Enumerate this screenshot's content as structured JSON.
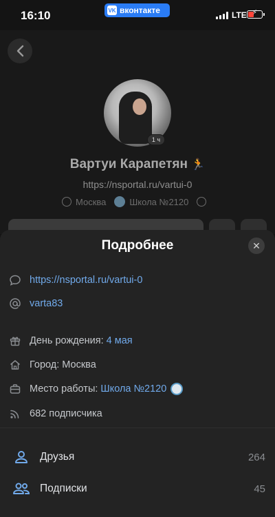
{
  "status_bar": {
    "time": "16:10",
    "app_pill": "вконтакте",
    "network": "LTE"
  },
  "profile": {
    "name": "Вартуи Карапетян",
    "status_emoji": "🏃",
    "link": "https://nsportal.ru/vartui-0",
    "city": "Москва",
    "school": "Школа №2120",
    "avatar_badge": "1 ч"
  },
  "sheet": {
    "title": "Подробнее",
    "close_icon": "close-icon",
    "website": "https://nsportal.ru/vartui-0",
    "nickname": "varta83",
    "birthday_label": "День рождения: ",
    "birthday_value": "4 мая",
    "city_label": "Город: Москва",
    "work_label": "Место работы: ",
    "work_value": "Школа №2120",
    "followers": "682 подписчика"
  },
  "stats": [
    {
      "label": "Друзья",
      "count": "264",
      "icon": "user-icon"
    },
    {
      "label": "Подписки",
      "count": "45",
      "icon": "users-icon"
    }
  ],
  "colors": {
    "accent": "#71aaeb",
    "background": "#141414",
    "sheet": "#232323",
    "vk_blue": "#2a7cf5"
  }
}
